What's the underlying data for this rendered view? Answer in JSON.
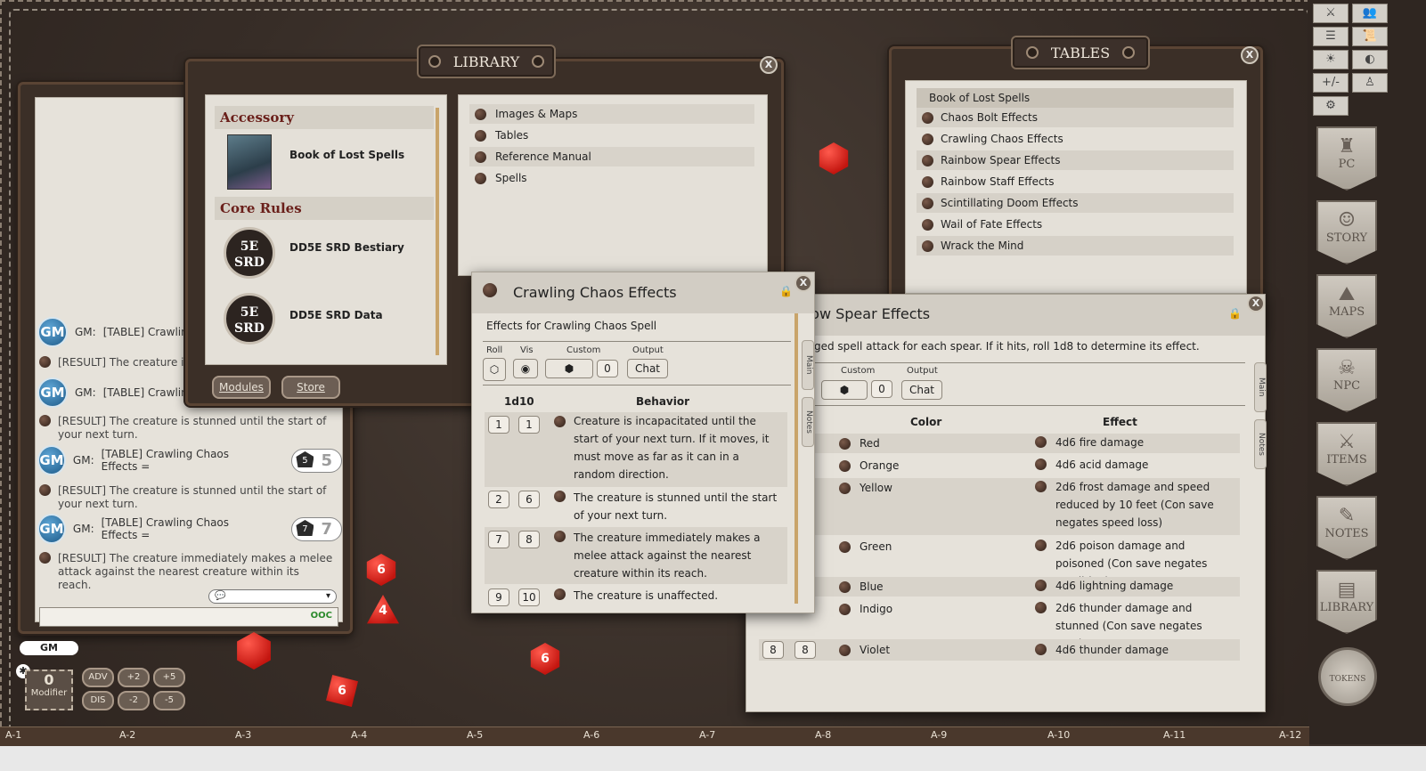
{
  "library": {
    "title": "LIBRARY",
    "sections": [
      {
        "heading": "Accessory",
        "items": [
          {
            "label": "Book of Lost Spells"
          }
        ]
      },
      {
        "heading": "Core Rules",
        "items": [
          {
            "label": "DD5E SRD Bestiary",
            "logo": "5E SRD"
          },
          {
            "label": "DD5E SRD Data",
            "logo": "5E SRD"
          }
        ]
      }
    ],
    "categories": [
      "Images & Maps",
      "Tables",
      "Reference Manual",
      "Spells"
    ],
    "modules_label": "Modules",
    "store_label": "Store"
  },
  "tables": {
    "title": "TABLES",
    "group": "Book of Lost Spells",
    "items": [
      "Chaos Bolt Effects",
      "Crawling Chaos Effects",
      "Rainbow Spear Effects",
      "Rainbow Staff Effects",
      "Scintillating Doom Effects",
      "Wail of Fate Effects",
      "Wrack the Mind"
    ]
  },
  "chat": {
    "entries": [
      {
        "speaker": "GM:",
        "text": "[TABLE] Crawling",
        "result": "[RESULT] The creature is u"
      },
      {
        "speaker": "GM:",
        "text": "[TABLE] Crawlin",
        "result": "[RESULT] The creature is stunned until the start of your next turn."
      },
      {
        "speaker": "GM:",
        "text": "[TABLE] Crawling Chaos Effects =",
        "roll": "5",
        "result": "[RESULT] The creature is stunned until the start of your next turn."
      },
      {
        "speaker": "GM:",
        "text": "[TABLE] Crawling Chaos Effects =",
        "roll": "7",
        "result": "[RESULT] The creature immediately makes a melee attack against the nearest creature within its reach."
      }
    ],
    "badge": "GM",
    "ooc": "OOC",
    "identity": "GM",
    "modifier_value": "0",
    "modifier_label": "Modifier",
    "mod_buttons": [
      "ADV",
      "+2",
      "+5",
      "DIS",
      "-2",
      "-5"
    ]
  },
  "crawling": {
    "title": "Crawling Chaos Effects",
    "description": "Effects for Crawling Chaos Spell",
    "labels": {
      "roll": "Roll",
      "vis": "Vis",
      "custom": "Custom",
      "output": "Output"
    },
    "custom_value": "0",
    "output_value": "Chat",
    "col_die": "1d10",
    "col_behavior": "Behavior",
    "tabs": [
      "Main",
      "Notes"
    ],
    "rows": [
      {
        "from": "1",
        "to": "1",
        "text": "Creature is incapacitated until the start of your next turn. If it moves, it must move as far as it can in a random direction."
      },
      {
        "from": "2",
        "to": "6",
        "text": "The creature is stunned until the start of your next turn."
      },
      {
        "from": "7",
        "to": "8",
        "text": "The creature immediately makes a melee attack against the nearest creature within its reach."
      },
      {
        "from": "9",
        "to": "10",
        "text": "The creature is unaffected."
      }
    ]
  },
  "rainbow": {
    "title": "bow Spear Effects",
    "description": "ged spell attack for each spear. If it hits, roll 1d8 to determine its effect.",
    "labels": {
      "custom": "Custom",
      "output": "Output"
    },
    "custom_value": "0",
    "output_value": "Chat",
    "col_color": "Color",
    "col_effect": "Effect",
    "tabs": [
      "Main",
      "Notes"
    ],
    "rows": [
      {
        "color": "Red",
        "effect": "4d6 fire damage"
      },
      {
        "color": "Orange",
        "effect": "4d6 acid damage"
      },
      {
        "color": "Yellow",
        "effect": "2d6 frost damage and speed reduced by 10 feet (Con save negates speed loss)"
      },
      {
        "color": "Green",
        "effect": "2d6 poison damage and poisoned (Con save negates condition)"
      },
      {
        "color": "Blue",
        "effect": "4d6 lightning damage"
      },
      {
        "color": "Indigo",
        "effect": "2d6 thunder damage and stunned (Con save negates stun)"
      },
      {
        "from": "8",
        "to": "8",
        "color": "Violet",
        "effect": "4d6 thunder damage"
      }
    ]
  },
  "sidebar": {
    "panels": [
      "PC",
      "STORY",
      "MAPS",
      "NPC",
      "ITEMS",
      "NOTES",
      "LIBRARY"
    ],
    "tokens": "TOKENS"
  },
  "grid": [
    "A-1",
    "A-2",
    "A-3",
    "A-4",
    "A-5",
    "A-6",
    "A-7",
    "A-8",
    "A-9",
    "A-10",
    "A-11",
    "A-12"
  ],
  "dice": [
    "6",
    "4",
    "6",
    "6"
  ],
  "colors": {
    "accent_red": "#6a1f1a",
    "gm_blue": "#2c74a8",
    "dice_red": "#d01c14"
  }
}
